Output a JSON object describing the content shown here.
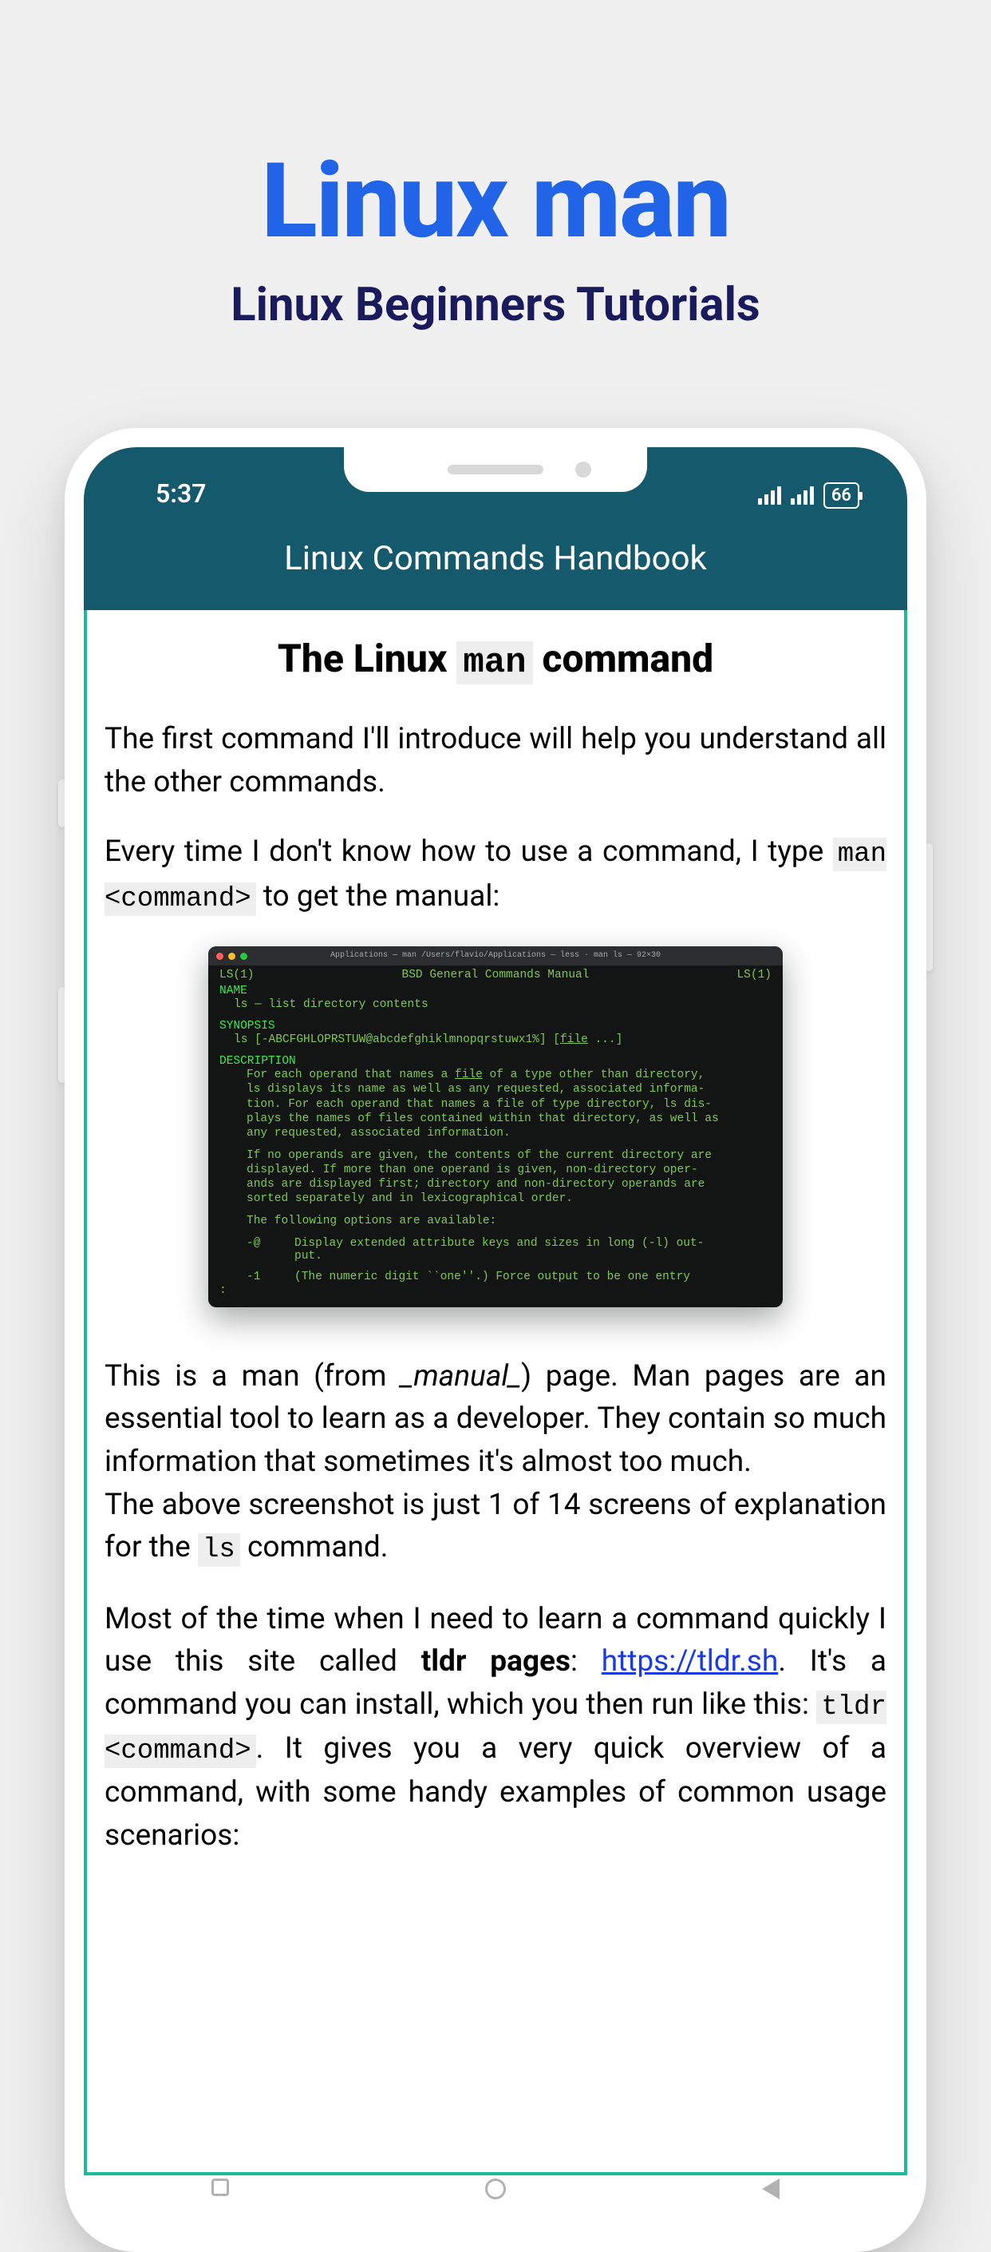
{
  "promo": {
    "title": "Linux man",
    "subtitle": "Linux Beginners Tutorials"
  },
  "status": {
    "time": "5:37",
    "battery": "66"
  },
  "app": {
    "header_title": "Linux Commands Handbook"
  },
  "article": {
    "heading_prefix": "The Linux ",
    "heading_code": "man",
    "heading_suffix": " command",
    "p1": "The first command I'll introduce will help you understand all the other commands.",
    "p2_a": "Every time I don't know how to use a command, I type ",
    "p2_code": "man <command>",
    "p2_b": " to get the manual:",
    "p3_a": "This is a man (from ",
    "p3_italic": "_manual_",
    "p3_b": ") page. Man pages are an essential tool to learn as a developer. They contain so much information that sometimes it's almost too much.",
    "p4_a": "The above screenshot is just 1 of 14 screens of explanation for the ",
    "p4_code": "ls",
    "p4_b": " command.",
    "p5_a": "Most of the time when I need to learn a command quickly I use this site called ",
    "p5_bold": "tldr pages",
    "p5_b": ": ",
    "p5_link": "https://tldr.sh",
    "p5_c": ". It's a command you can install, which you then run like this: ",
    "p5_code": "tldr <command>",
    "p5_d": ". It gives you a very quick overview of a command, with some handy examples of common usage scenarios:"
  },
  "terminal": {
    "title": "Applications — man /Users/flavio/Applications — less · man ls — 92×30",
    "hdr_left": "LS(1)",
    "hdr_center": "BSD General Commands Manual",
    "hdr_right": "LS(1)",
    "sec_name": "NAME",
    "name_line": "ls — list directory contents",
    "sec_syn": "SYNOPSIS",
    "syn_line_a": "ls [-ABCFGHLOPRSTUW@abcdefghiklmnopqrstuwx1%] [",
    "syn_file": "file",
    "syn_line_b": " ...]",
    "sec_desc": "DESCRIPTION",
    "desc_1a": "For each operand that names a ",
    "desc_1file": "file",
    "desc_1b": " of a type other than directory,",
    "desc_2": "ls displays its name as well as any requested, associated informa-",
    "desc_3": "tion.  For each operand that names a file of type directory, ls dis-",
    "desc_4": "plays the names of files contained within that directory, as well as",
    "desc_5": "any requested, associated information.",
    "desc_6": "If no operands are given, the contents of the current directory are",
    "desc_7": "displayed.  If more than one operand is given, non-directory oper-",
    "desc_8": "ands are displayed first; directory and non-directory operands are",
    "desc_9": "sorted separately and in lexicographical order.",
    "desc_10": "The following options are available:",
    "opt1_flag": "-@",
    "opt1_a": "Display extended attribute keys and sizes in long (-l) out-",
    "opt1_b": "put.",
    "opt2_flag": "-1",
    "opt2": "(The numeric digit ``one''.)  Force output to be one entry",
    "prompt": ":"
  }
}
